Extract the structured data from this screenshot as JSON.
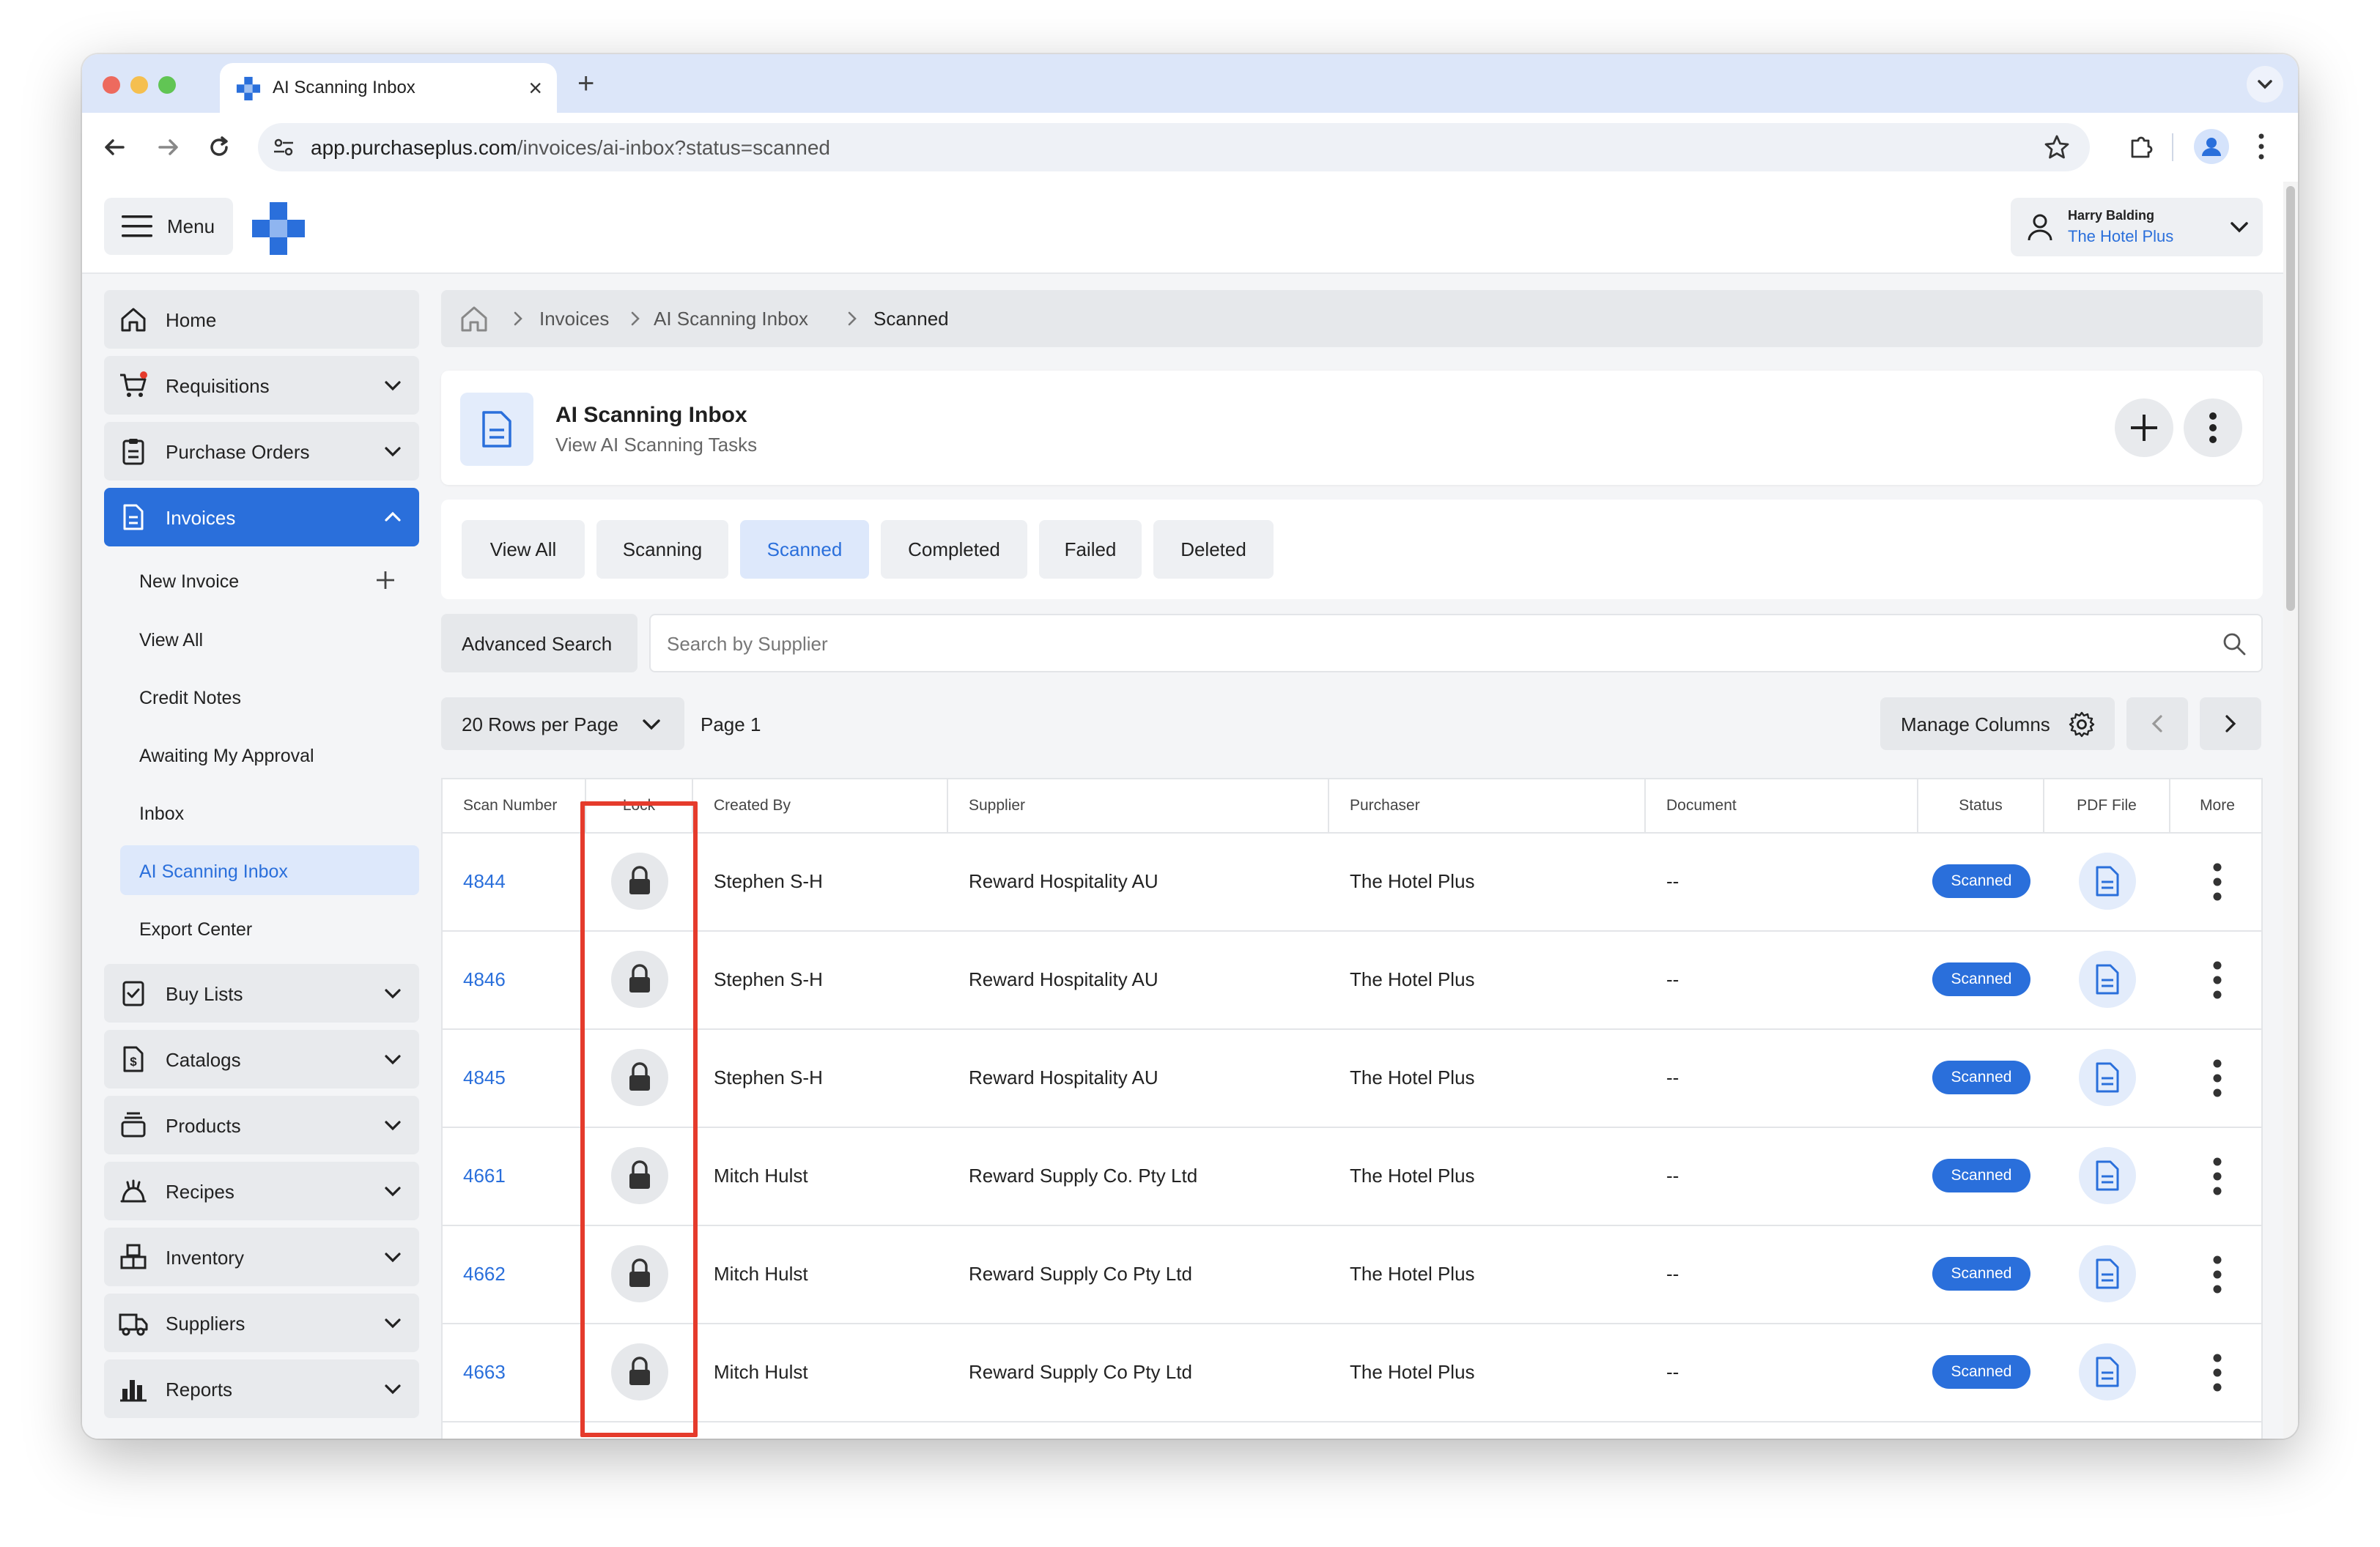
{
  "browser": {
    "tab_title": "AI Scanning Inbox",
    "new_tab_symbol": "+",
    "close_symbol": "×",
    "url_host": "app.purchaseplus.com",
    "url_path": "/invoices/ai-inbox?status=scanned"
  },
  "topbar": {
    "menu_label": "Menu",
    "user_name": "Harry Balding",
    "user_org": "The Hotel Plus"
  },
  "sidebar": {
    "items": [
      {
        "label": "Home",
        "icon": "home-icon"
      },
      {
        "label": "Requisitions",
        "icon": "cart-icon"
      },
      {
        "label": "Purchase Orders",
        "icon": "clipboard-icon"
      },
      {
        "label": "Invoices",
        "icon": "document-icon"
      },
      {
        "label": "Buy Lists",
        "icon": "checklist-icon"
      },
      {
        "label": "Catalogs",
        "icon": "dollar-doc-icon"
      },
      {
        "label": "Products",
        "icon": "stack-icon"
      },
      {
        "label": "Recipes",
        "icon": "chef-icon"
      },
      {
        "label": "Inventory",
        "icon": "boxes-icon"
      },
      {
        "label": "Suppliers",
        "icon": "truck-icon"
      },
      {
        "label": "Reports",
        "icon": "bar-chart-icon"
      }
    ],
    "invoice_subitems": [
      {
        "label": "New Invoice"
      },
      {
        "label": "View All"
      },
      {
        "label": "Credit Notes"
      },
      {
        "label": "Awaiting My Approval"
      },
      {
        "label": "Inbox"
      },
      {
        "label": "AI Scanning Inbox"
      },
      {
        "label": "Export Center"
      }
    ]
  },
  "breadcrumb": [
    "Invoices",
    "AI Scanning Inbox",
    "Scanned"
  ],
  "header": {
    "title": "AI Scanning Inbox",
    "subtitle": "View AI Scanning Tasks"
  },
  "filter_tabs": [
    "View All",
    "Scanning",
    "Scanned",
    "Completed",
    "Failed",
    "Deleted"
  ],
  "active_tab": "Scanned",
  "search": {
    "advanced_label": "Advanced Search",
    "placeholder": "Search by Supplier",
    "value": ""
  },
  "pagination": {
    "rows_per_page_label": "20 Rows per Page",
    "page_label": "Page 1",
    "manage_columns_label": "Manage Columns"
  },
  "table": {
    "columns": [
      "Scan Number",
      "Lock",
      "Created By",
      "Supplier",
      "Purchaser",
      "Document",
      "Status",
      "PDF File",
      "More"
    ],
    "rows": [
      {
        "scan": "4844",
        "created_by": "Stephen S-H",
        "supplier": "Reward Hospitality AU",
        "purchaser": "The Hotel Plus",
        "document": "--",
        "status": "Scanned"
      },
      {
        "scan": "4846",
        "created_by": "Stephen S-H",
        "supplier": "Reward Hospitality AU",
        "purchaser": "The Hotel Plus",
        "document": "--",
        "status": "Scanned"
      },
      {
        "scan": "4845",
        "created_by": "Stephen S-H",
        "supplier": "Reward Hospitality AU",
        "purchaser": "The Hotel Plus",
        "document": "--",
        "status": "Scanned"
      },
      {
        "scan": "4661",
        "created_by": "Mitch Hulst",
        "supplier": "Reward Supply Co. Pty Ltd",
        "purchaser": "The Hotel Plus",
        "document": "--",
        "status": "Scanned"
      },
      {
        "scan": "4662",
        "created_by": "Mitch Hulst",
        "supplier": "Reward Supply Co Pty Ltd",
        "purchaser": "The Hotel Plus",
        "document": "--",
        "status": "Scanned"
      },
      {
        "scan": "4663",
        "created_by": "Mitch Hulst",
        "supplier": "Reward Supply Co Pty Ltd",
        "purchaser": "The Hotel Plus",
        "document": "--",
        "status": "Scanned"
      }
    ]
  },
  "colors": {
    "accent": "#2a6fdb",
    "highlight": "#e53b2c",
    "tab_strip": "#dce6f9"
  }
}
